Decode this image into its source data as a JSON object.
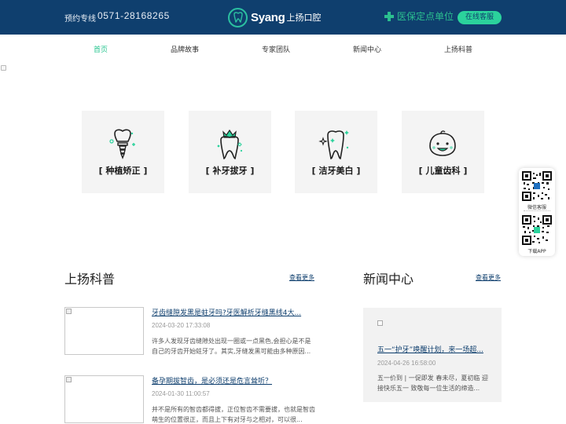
{
  "header": {
    "hotline_label": "预约专线",
    "hotline_number": "0571-28168265",
    "logo_text": "Syang",
    "logo_cn": "上扬口腔",
    "insurance_text": "医保定点单位",
    "online_service": "在线客服"
  },
  "nav": {
    "items": [
      {
        "label": "首页",
        "active": true
      },
      {
        "label": "品牌故事",
        "active": false
      },
      {
        "label": "专家团队",
        "active": false
      },
      {
        "label": "新闻中心",
        "active": false
      },
      {
        "label": "上扬科普",
        "active": false
      }
    ]
  },
  "services": [
    {
      "label": "[ 种植矫正 ]",
      "icon": "implant-tooth-icon"
    },
    {
      "label": "[ 补牙拔牙 ]",
      "icon": "crown-tooth-icon"
    },
    {
      "label": "[ 洁牙美白 ]",
      "icon": "sparkle-tooth-icon"
    },
    {
      "label": "[ 儿童齿科 ]",
      "icon": "child-face-icon"
    }
  ],
  "float_widget": {
    "wechat_label": "微信客服",
    "app_label": "下载APP"
  },
  "science": {
    "title": "上扬科普",
    "more": "查看更多",
    "articles": [
      {
        "title": "牙齿缝隙发黑是蛀牙吗?牙医解析牙缝黑线4大...",
        "date": "2024-03-20 17:33:08",
        "excerpt": "许多人发现牙齿缝隙处出现一圈或一点黑色,会担心是不是自己的牙齿开始蛀牙了。其实,牙缝发黑可能由多种原因..."
      },
      {
        "title": "备孕期拔智齿，是必须还是危言耸听？",
        "date": "2024-01-30 11:00:57",
        "excerpt": "并不是所有的智齿都得拔，正位智齿不需要拔，也就是智齿萌生的位置很正，而且上下有对牙与之相对，可以很..."
      }
    ]
  },
  "news": {
    "title": "新闻中心",
    "more": "查看更多",
    "item": {
      "title": "五一“护牙”唤醒计划，来一场超...",
      "date": "2024-04-26 16:58:00",
      "excerpt": "五一价到 | 一促即发 春未尽，夏初临 迎接快乐五一 致敬每一位生活的缔造..."
    }
  },
  "colors": {
    "header_bg": "#0f3f6e",
    "accent_green": "#2bd29c",
    "nav_active": "#27c48f",
    "card_bg": "#f4f4f4"
  }
}
